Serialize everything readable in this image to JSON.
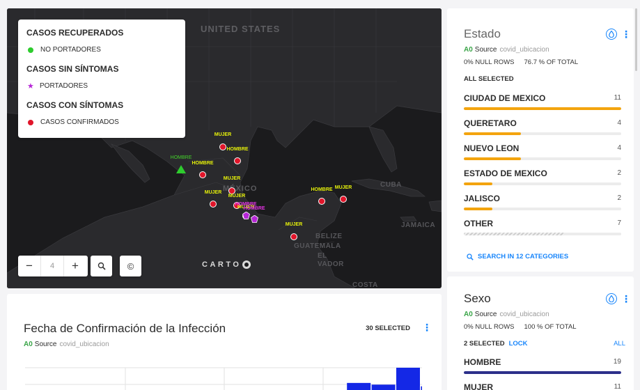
{
  "map": {
    "labels": {
      "usa": "UNITED STATES",
      "mexico": "MÉXICO",
      "cuba": "CUBA",
      "jamaica": "JAMAICA",
      "belize": "BELIZE",
      "guatemala": "GUATEMALA",
      "salvador": "EL\nVADOR",
      "costa": "COSTA"
    },
    "legend": {
      "sections": [
        {
          "title": "CASOS RECUPERADOS",
          "item": "NO PORTADORES",
          "color": "#2ecc2e",
          "shape": "circle"
        },
        {
          "title": "CASOS SIN SÍNTOMAS",
          "item": "PORTADORES",
          "color": "#b627d6",
          "shape": "star"
        },
        {
          "title": "CASOS CON SÍNTOMAS",
          "item": "CASOS CONFIRMADOS",
          "color": "#e0152a",
          "shape": "circle"
        }
      ]
    },
    "zoom": {
      "level": "4",
      "minus": "−",
      "plus": "+"
    },
    "attribution_icon": "©",
    "logo": "CARTO",
    "markers": [
      {
        "label": "MUJER",
        "color": "#e0152a"
      },
      {
        "label": "HOMBRE",
        "color": "#e0152a"
      },
      {
        "label": "HOMBRE",
        "color": "#e0152a"
      },
      {
        "label": "MUJER",
        "color": "#e0152a"
      },
      {
        "label": "MUJER",
        "color": "#e0152a"
      },
      {
        "label": "HOMBRE",
        "color": "#e0152a"
      },
      {
        "label": "MUJER",
        "color": "#e0152a"
      },
      {
        "label": "MUJER",
        "color": "#e0152a"
      },
      {
        "label": "MUJER",
        "color": "#e0152a"
      },
      {
        "label": "MUJER",
        "color": "#e0152a"
      },
      {
        "label": "HOMBRE",
        "color": "#2ecc2e"
      },
      {
        "label": "HOMBRE",
        "color": "#b627d6"
      },
      {
        "label": "HOMBRE",
        "color": "#b627d6"
      }
    ]
  },
  "estado": {
    "title": "Estado",
    "source_tag": "A0",
    "source_label": "Source",
    "source_name": "covid_ubicacion",
    "null_rows": "0% NULL ROWS",
    "pct_total": "76.7 % OF TOTAL",
    "selection": "ALL SELECTED",
    "categories": [
      {
        "name": "CIUDAD DE MEXICO",
        "count": "11",
        "fraction": 1.0
      },
      {
        "name": "QUERETARO",
        "count": "4",
        "fraction": 0.364
      },
      {
        "name": "NUEVO LEON",
        "count": "4",
        "fraction": 0.364
      },
      {
        "name": "ESTADO DE MEXICO",
        "count": "2",
        "fraction": 0.182
      },
      {
        "name": "JALISCO",
        "count": "2",
        "fraction": 0.182
      },
      {
        "name": "OTHER",
        "count": "7",
        "fraction": 0.636
      }
    ],
    "search_link": "SEARCH IN 12 CATEGORIES"
  },
  "sexo": {
    "title": "Sexo",
    "source_tag": "A0",
    "source_label": "Source",
    "source_name": "covid_ubicacion",
    "null_rows": "0% NULL ROWS",
    "pct_total": "100 % OF TOTAL",
    "selection": "2 SELECTED",
    "lock": "LOCK",
    "all": "ALL",
    "categories": [
      {
        "name": "HOMBRE",
        "count": "19",
        "fraction": 1.0
      },
      {
        "name": "MUJER",
        "count": "11",
        "fraction": 0.579
      }
    ]
  },
  "timeseries": {
    "title": "Fecha de Confirmación de la Infección",
    "selected": "30 SELECTED",
    "source_tag": "A0",
    "source_label": "Source",
    "source_name": "covid_ubicacion"
  },
  "chart_data": {
    "type": "bar",
    "note_visible": "partial histogram, only upper portion visible",
    "values": [
      0,
      0,
      0,
      0,
      0,
      0,
      0,
      0,
      0,
      0,
      0,
      0,
      0,
      5,
      4,
      14,
      3
    ],
    "color": "#1428e6"
  }
}
